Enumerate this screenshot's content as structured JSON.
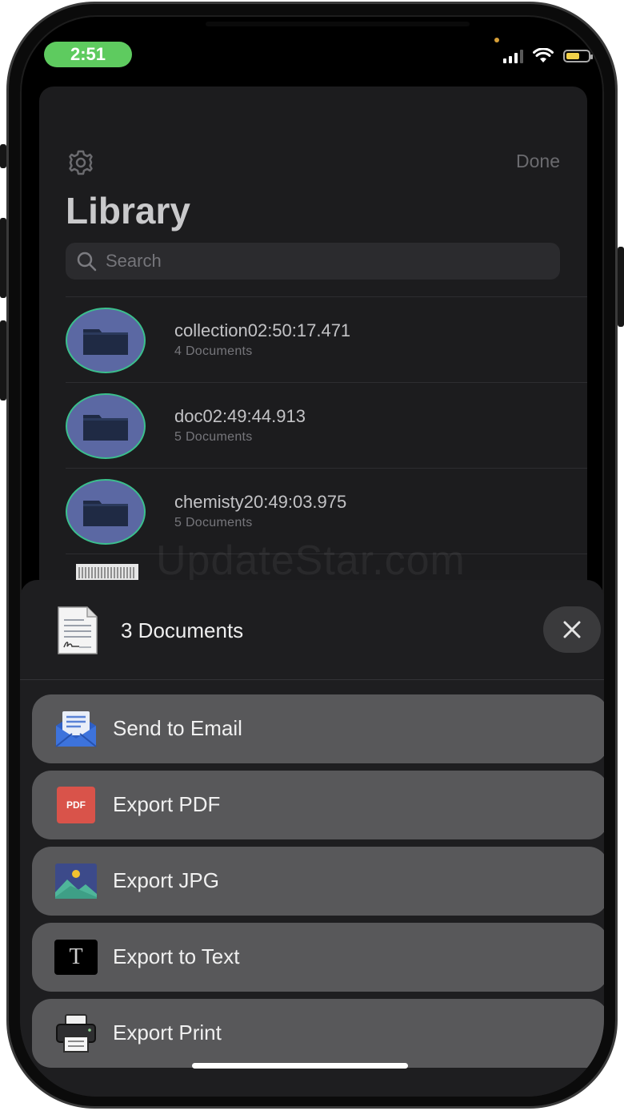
{
  "status_bar": {
    "time": "2:51"
  },
  "library": {
    "done_label": "Done",
    "title": "Library",
    "search_placeholder": "Search",
    "items": [
      {
        "name": "collection02:50:17.471",
        "subtitle": "4 Documents"
      },
      {
        "name": "doc02:49:44.913",
        "subtitle": "5 Documents"
      },
      {
        "name": "chemisty20:49:03.975",
        "subtitle": "5 Documents"
      }
    ]
  },
  "watermark": "UpdateStar.com",
  "share_sheet": {
    "title": "3 Documents",
    "actions": [
      {
        "label": "Send to Email",
        "icon": "email-icon"
      },
      {
        "label": "Export PDF",
        "icon": "pdf-icon",
        "icon_text": "PDF"
      },
      {
        "label": "Export JPG",
        "icon": "image-icon"
      },
      {
        "label": "Export to Text",
        "icon": "text-icon",
        "icon_text": "T"
      },
      {
        "label": "Export Print",
        "icon": "printer-icon"
      }
    ]
  },
  "colors": {
    "time_pill": "#5ecb5f",
    "battery": "#f1d14a",
    "action_bg": "#58585a",
    "pdf_red": "#d9534a"
  }
}
